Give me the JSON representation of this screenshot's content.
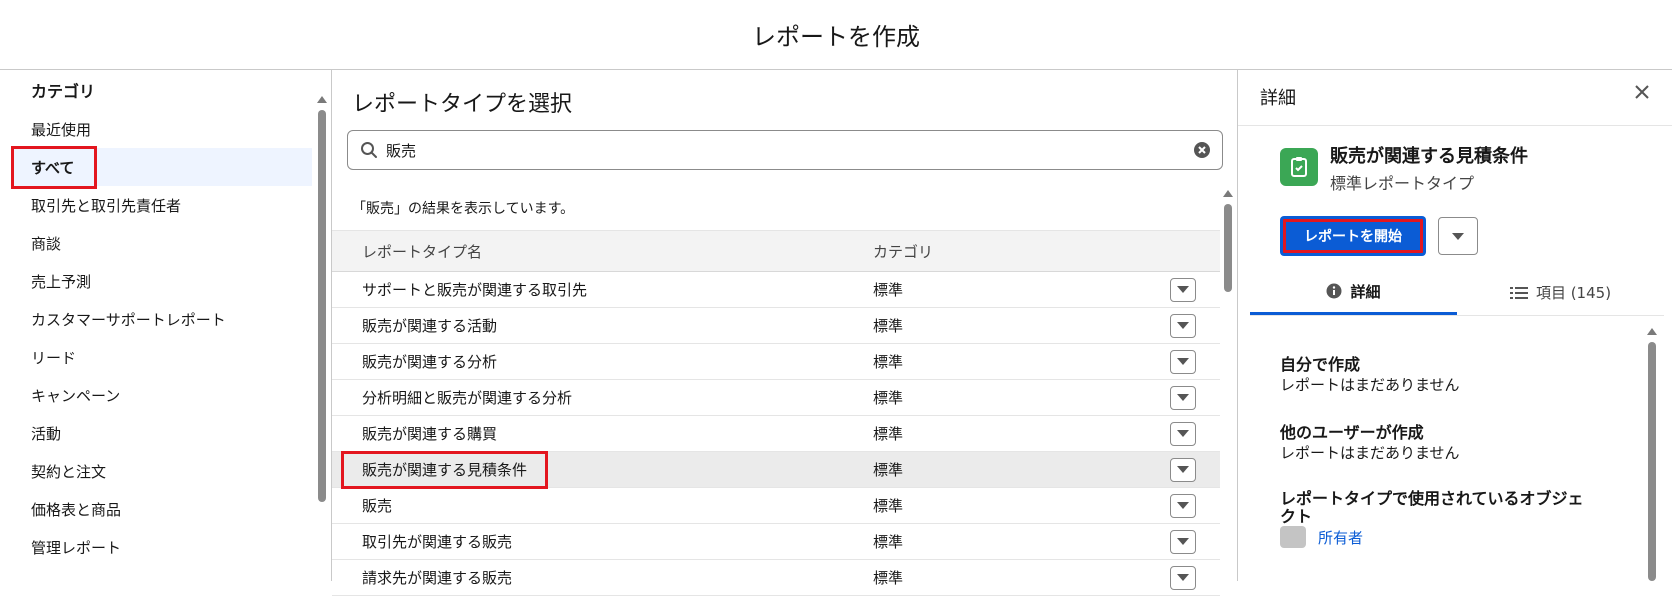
{
  "header": {
    "title": "レポートを作成"
  },
  "categories": {
    "heading": "カテゴリ",
    "items": [
      {
        "label": "最近使用"
      },
      {
        "label": "すべて",
        "selected": true
      },
      {
        "label": "取引先と取引先責任者"
      },
      {
        "label": "商談"
      },
      {
        "label": "売上予測"
      },
      {
        "label": "カスタマーサポートレポート"
      },
      {
        "label": "リード"
      },
      {
        "label": "キャンペーン"
      },
      {
        "label": "活動"
      },
      {
        "label": "契約と注文"
      },
      {
        "label": "価格表と商品"
      },
      {
        "label": "管理レポート"
      }
    ]
  },
  "selector": {
    "title": "レポートタイプを選択",
    "search": {
      "value": "販売",
      "icon": "search-icon",
      "clear_icon": "clear-icon"
    },
    "result_message": "「販売」の結果を表示しています。",
    "columns": {
      "name": "レポートタイプ名",
      "category": "カテゴリ"
    },
    "rows": [
      {
        "name": "サポートと販売が関連する取引先",
        "category": "標準"
      },
      {
        "name": "販売が関連する活動",
        "category": "標準"
      },
      {
        "name": "販売が関連する分析",
        "category": "標準"
      },
      {
        "name": "分析明細と販売が関連する分析",
        "category": "標準"
      },
      {
        "name": "販売が関連する購買",
        "category": "標準"
      },
      {
        "name": "販売が関連する見積条件",
        "category": "標準",
        "selected": true
      },
      {
        "name": "販売",
        "category": "標準"
      },
      {
        "name": "取引先が関連する販売",
        "category": "標準"
      },
      {
        "name": "請求先が関連する販売",
        "category": "標準"
      }
    ]
  },
  "details": {
    "title": "詳細",
    "object_name": "販売が関連する見積条件",
    "object_type": "標準レポートタイプ",
    "start_button": "レポートを開始",
    "tabs": {
      "details": "詳細",
      "fields": "項目 (145)"
    },
    "sections": {
      "created_by_me": {
        "title": "自分で作成",
        "text": "レポートはまだありません"
      },
      "created_by_others": {
        "title": "他のユーザーが作成",
        "text": "レポートはまだありません"
      },
      "objects_used": {
        "title": "レポートタイプで使用されているオブジェクト"
      }
    },
    "owner_link": "所有者"
  },
  "colors": {
    "accent": "#0b5cd5",
    "highlight": "#e3161f",
    "icon_green": "#3ba755"
  }
}
